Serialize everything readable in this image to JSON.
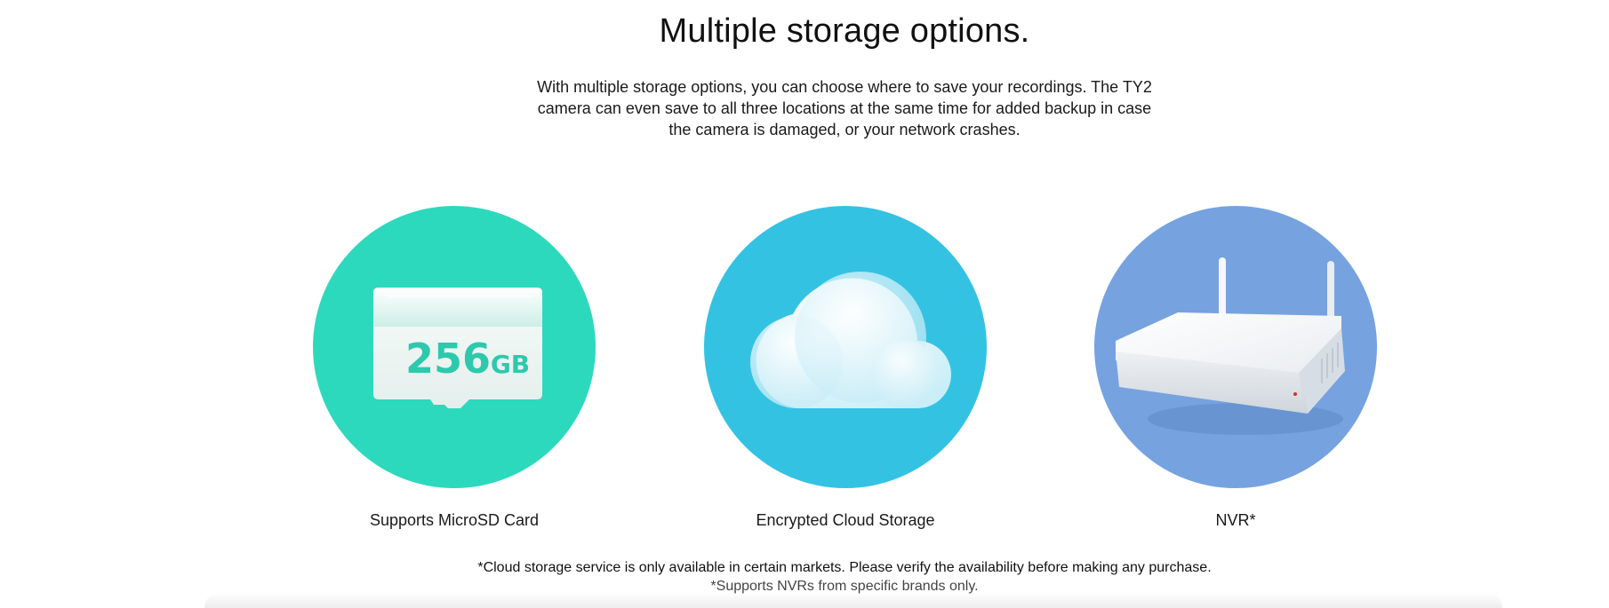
{
  "section": {
    "title": "Multiple storage options.",
    "description": "With multiple storage options, you can choose where to save your recordings. The TY2 camera can even save to all three locations at the same time for added backup in case the camera is damaged, or your network crashes."
  },
  "options": [
    {
      "label": "Supports MicroSD Card",
      "icon": "microsd-card-icon",
      "color": "#2dd9bd",
      "card_capacity": "256",
      "card_unit": "GB"
    },
    {
      "label": "Encrypted Cloud Storage",
      "icon": "cloud-icon",
      "color": "#34c2e3"
    },
    {
      "label": "NVR*",
      "icon": "nvr-device-icon",
      "color": "#76a2e0"
    }
  ],
  "footnotes": {
    "cloud": "*Cloud storage service is only available in certain markets. Please verify the availability before making any purchase.",
    "nvr": "*Supports NVRs from specific brands only."
  }
}
